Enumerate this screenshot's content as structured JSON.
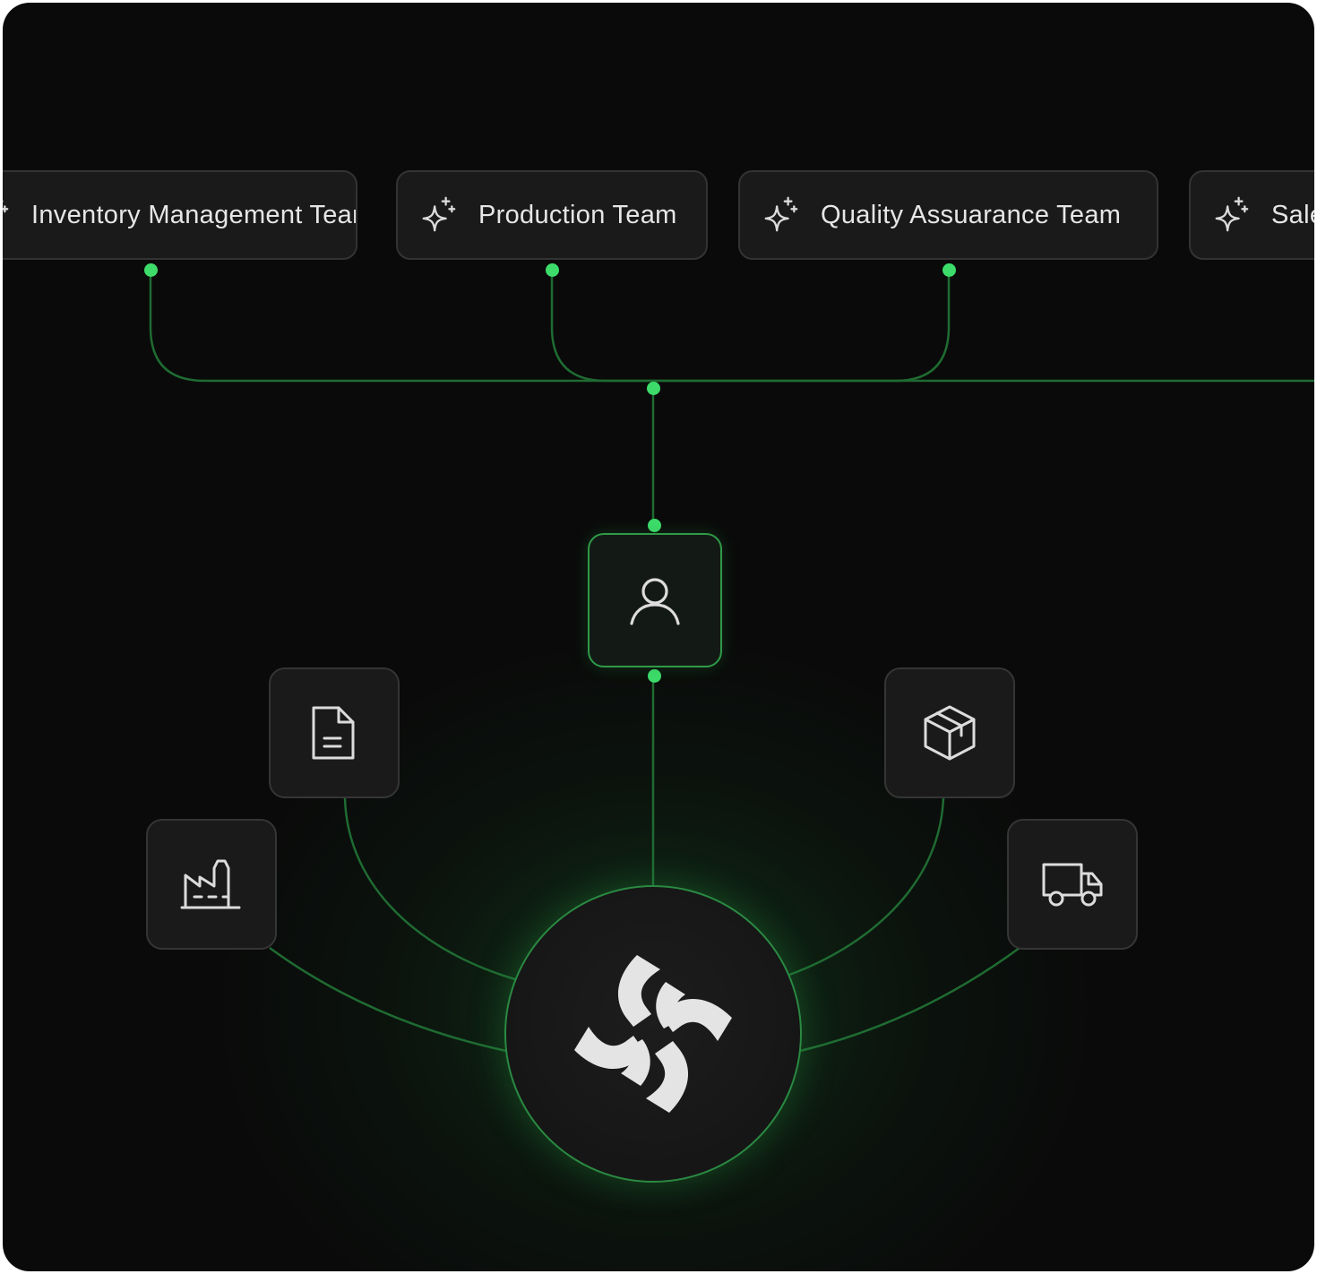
{
  "diagram": {
    "teams": [
      {
        "label": "Inventory Management Team",
        "icon": "sparkle-icon"
      },
      {
        "label": "Production Team",
        "icon": "sparkle-icon"
      },
      {
        "label": "Quality Assuarance Team",
        "icon": "sparkle-icon"
      },
      {
        "label": "Sales Team",
        "icon": "sparkle-icon"
      }
    ],
    "agent_node": {
      "icon": "user-icon"
    },
    "resource_nodes": [
      {
        "icon": "document-icon"
      },
      {
        "icon": "factory-icon"
      },
      {
        "icon": "package-icon"
      },
      {
        "icon": "truck-icon"
      }
    ],
    "hub": {
      "icon": "logo-icon"
    },
    "colors": {
      "background": "#0a0a0a",
      "accent": "#3ddc6a",
      "wire": "#1f6b32",
      "card": "#1a1a1a",
      "card_border": "#333333",
      "text": "#e6e6e6"
    }
  }
}
